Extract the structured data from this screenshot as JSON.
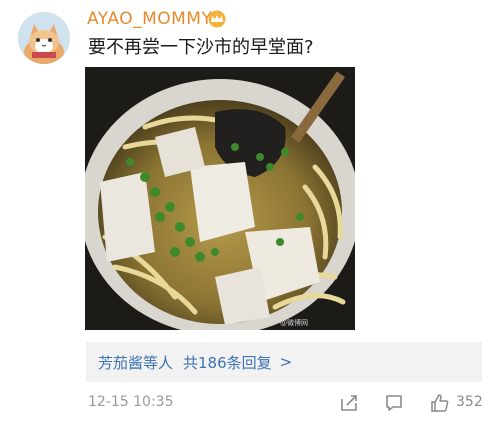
{
  "comment": {
    "username": "AYAO_MOMMY",
    "text": "要不再尝一下沙市的早堂面?",
    "avatar_icon": "cat-avatar-icon",
    "badge_icon": "vip-crown-icon",
    "image_watermark": "@微博网"
  },
  "replies": {
    "author": "芳茄酱等人",
    "summary": "共186条回复",
    "arrow": ">"
  },
  "footer": {
    "timestamp": "12-15 10:35",
    "like_count": "352",
    "icons": [
      "share-icon",
      "comment-icon",
      "like-icon"
    ]
  },
  "colors": {
    "username": "#e58a2a",
    "link": "#3c74b4",
    "meta": "#9a9a9a",
    "reply_bg": "#f2f2f2"
  }
}
